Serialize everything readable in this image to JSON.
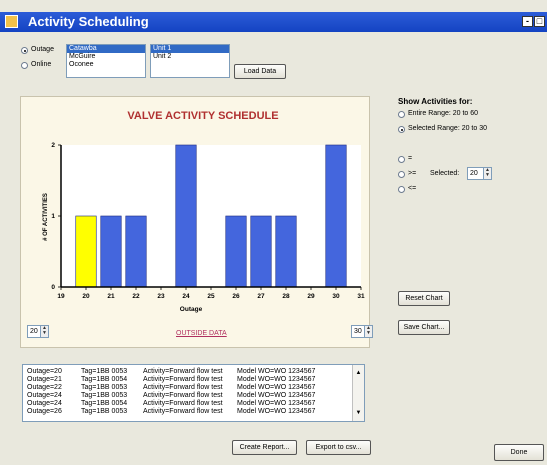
{
  "window": {
    "title": "Activity Scheduling",
    "buttons": [
      "-",
      "□"
    ]
  },
  "source": {
    "options": [
      {
        "label": "Outage",
        "checked": true
      },
      {
        "label": "Online",
        "checked": false
      }
    ],
    "plants": [
      {
        "label": "Catawba",
        "selected": true
      },
      {
        "label": "McGuire",
        "selected": false
      },
      {
        "label": "Oconee",
        "selected": false
      }
    ],
    "units": [
      {
        "label": "Unit 1",
        "selected": true
      },
      {
        "label": "Unit 2",
        "selected": false
      }
    ],
    "load_label": "Load Data"
  },
  "chart_data": {
    "type": "bar",
    "title": "VALVE ACTIVITY SCHEDULE",
    "xlabel": "Outage",
    "ylabel": "# OF ACTIVITIES",
    "x_ticks": [
      19,
      20,
      21,
      22,
      23,
      24,
      25,
      26,
      27,
      28,
      29,
      30,
      31
    ],
    "y_ticks": [
      0,
      1,
      2
    ],
    "xlim": [
      19,
      31
    ],
    "ylim": [
      0,
      2
    ],
    "categories": [
      20,
      21,
      22,
      24,
      26,
      27,
      28,
      30
    ],
    "values": [
      1,
      1,
      1,
      2,
      1,
      1,
      1,
      2
    ],
    "highlight": 20,
    "colors": {
      "bar": "#4466dd",
      "highlight": "#ffff00",
      "title": "#b03030"
    }
  },
  "range": {
    "from": "20",
    "to": "30",
    "outside_label": "OUTSIDE DATA"
  },
  "show": {
    "heading": "Show Activities for:",
    "options": [
      {
        "label": "Entire Range: 20 to 60",
        "checked": false
      },
      {
        "label": "Selected Range: 20 to 30",
        "checked": true
      }
    ],
    "comparisons": [
      {
        "label": "=",
        "checked": false
      },
      {
        "label": ">=",
        "checked": false
      },
      {
        "label": "<=",
        "checked": false
      }
    ],
    "selected_label": "Selected:",
    "selected_value": "20"
  },
  "buttons": {
    "reset": "Reset Chart",
    "save": "Save Chart...",
    "report": "Create Report...",
    "export": "Export to csv...",
    "done": "Done"
  },
  "log": [
    {
      "outage": "Outage=20",
      "tag": "Tag=1BB 0053",
      "activity": "Activity=Forward flow test",
      "model": "Model WO=WO 1234567"
    },
    {
      "outage": "Outage=21",
      "tag": "Tag=1BB 0054",
      "activity": "Activity=Forward flow test",
      "model": "Model WO=WO 1234567"
    },
    {
      "outage": "Outage=22",
      "tag": "Tag=1BB 0053",
      "activity": "Activity=Forward flow test",
      "model": "Model WO=WO 1234567"
    },
    {
      "outage": "Outage=24",
      "tag": "Tag=1BB 0053",
      "activity": "Activity=Forward flow test",
      "model": "Model WO=WO 1234567"
    },
    {
      "outage": "Outage=24",
      "tag": "Tag=1BB 0054",
      "activity": "Activity=Forward flow test",
      "model": "Model WO=WO 1234567"
    },
    {
      "outage": "Outage=26",
      "tag": "Tag=1BB 0053",
      "activity": "Activity=Forward flow test",
      "model": "Model WO=WO 1234567"
    }
  ]
}
